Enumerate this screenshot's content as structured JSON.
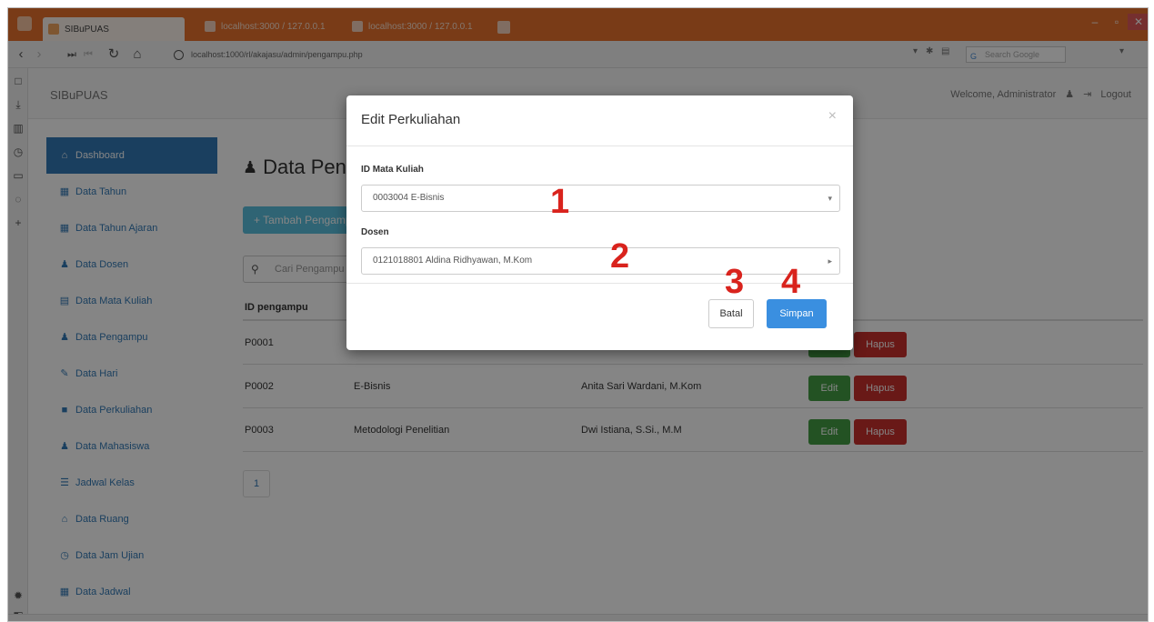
{
  "browser": {
    "tabs": [
      {
        "label": "SIBuPUAS"
      },
      {
        "label": "localhost:3000 / 127.0.0.1"
      },
      {
        "label": "localhost:3000 / 127.0.0.1"
      }
    ],
    "url": "localhost:1000/rl/akajasu/admin/pengampu.php",
    "search_placeholder": "Search Google",
    "window_controls": {
      "min": "–",
      "max": "▫",
      "close": "✕"
    }
  },
  "page": {
    "brand": "SIBuPUAS",
    "welcome": "Welcome, Administrator",
    "logout": "Logout",
    "sidebar": [
      {
        "label": "Dashboard",
        "icon": "home-icon",
        "glyph": "⌂",
        "active": true
      },
      {
        "label": "Data Tahun",
        "icon": "calendar-icon",
        "glyph": "▦"
      },
      {
        "label": "Data Tahun Ajaran",
        "icon": "calendar-icon",
        "glyph": "▦"
      },
      {
        "label": "Data Dosen",
        "icon": "user-icon",
        "glyph": "♟"
      },
      {
        "label": "Data Mata Kuliah",
        "icon": "book-icon",
        "glyph": "▤"
      },
      {
        "label": "Data Pengampu",
        "icon": "user-icon",
        "glyph": "♟"
      },
      {
        "label": "Data Hari",
        "icon": "edit-icon",
        "glyph": "✎"
      },
      {
        "label": "Data Perkuliahan",
        "icon": "bookmark-icon",
        "glyph": "■"
      },
      {
        "label": "Data Mahasiswa",
        "icon": "user-icon",
        "glyph": "♟"
      },
      {
        "label": "Jadwal Kelas",
        "icon": "list-icon",
        "glyph": "☰"
      },
      {
        "label": "Data Ruang",
        "icon": "home-icon",
        "glyph": "⌂"
      },
      {
        "label": "Data Jam Ujian",
        "icon": "clock-icon",
        "glyph": "◷"
      },
      {
        "label": "Data Jadwal",
        "icon": "table-icon",
        "glyph": "▦"
      }
    ],
    "heading": "Data Pengampu",
    "add_button": "+ Tambah Pengampu",
    "search_placeholder": "Cari Pengampu",
    "table": {
      "headers": [
        "ID pengampu"
      ],
      "rows": [
        {
          "id": "P0001",
          "mk": "",
          "dosen": ""
        },
        {
          "id": "P0002",
          "mk": "E-Bisnis",
          "dosen": "Anita Sari Wardani, M.Kom"
        },
        {
          "id": "P0003",
          "mk": "Metodologi Penelitian",
          "dosen": "Dwi Istiana, S.Si., M.M"
        }
      ],
      "edit_label": "Edit",
      "delete_label": "Hapus"
    },
    "pagination": "1"
  },
  "modal": {
    "title": "Edit Perkuliahan",
    "close": "×",
    "field1_label": "ID Mata Kuliah",
    "field1_value": "0003004 E-Bisnis",
    "field2_label": "Dosen",
    "field2_value": "0121018801 Aldina Ridhyawan, M.Kom",
    "cancel_label": "Batal",
    "save_label": "Simpan"
  },
  "annotations": [
    "1",
    "2",
    "3",
    "4"
  ],
  "colors": {
    "titlebar": "#e9722c",
    "primary": "#337ab7",
    "success": "#449d44",
    "danger": "#c9302c",
    "annotation": "#d9231d"
  }
}
